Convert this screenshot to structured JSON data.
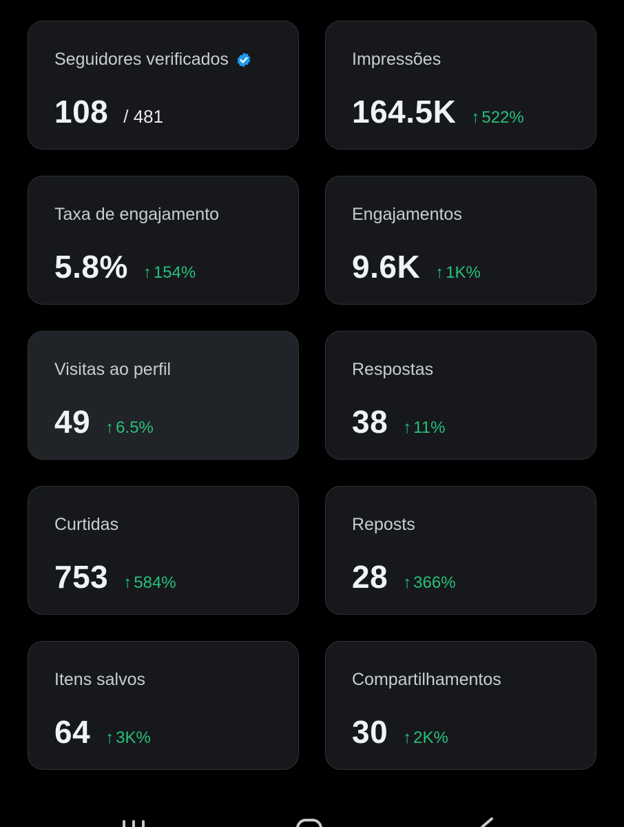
{
  "cards": [
    {
      "label": "Seguidores verificados",
      "value": "108",
      "total": "/ 481",
      "verified": true
    },
    {
      "label": "Impressões",
      "value": "164.5K",
      "change": "522%"
    },
    {
      "label": "Taxa de engajamento",
      "value": "5.8%",
      "change": "154%"
    },
    {
      "label": "Engajamentos",
      "value": "9.6K",
      "change": "1K%"
    },
    {
      "label": "Visitas ao perfil",
      "value": "49",
      "change": "6.5%"
    },
    {
      "label": "Respostas",
      "value": "38",
      "change": "11%"
    },
    {
      "label": "Curtidas",
      "value": "753",
      "change": "584%"
    },
    {
      "label": "Reposts",
      "value": "28",
      "change": "366%"
    },
    {
      "label": "Itens salvos",
      "value": "64",
      "change": "3K%"
    },
    {
      "label": "Compartilhamentos",
      "value": "30",
      "change": "2K%"
    }
  ],
  "icons": {
    "change": "arrow-up-icon",
    "verified": "verified-badge-icon"
  },
  "colors": {
    "background": "#000000",
    "card": "#16181c",
    "card_highlight": "#202327",
    "border": "#2f3336",
    "positive": "#27c07a",
    "verified": "#1d9bf0"
  }
}
